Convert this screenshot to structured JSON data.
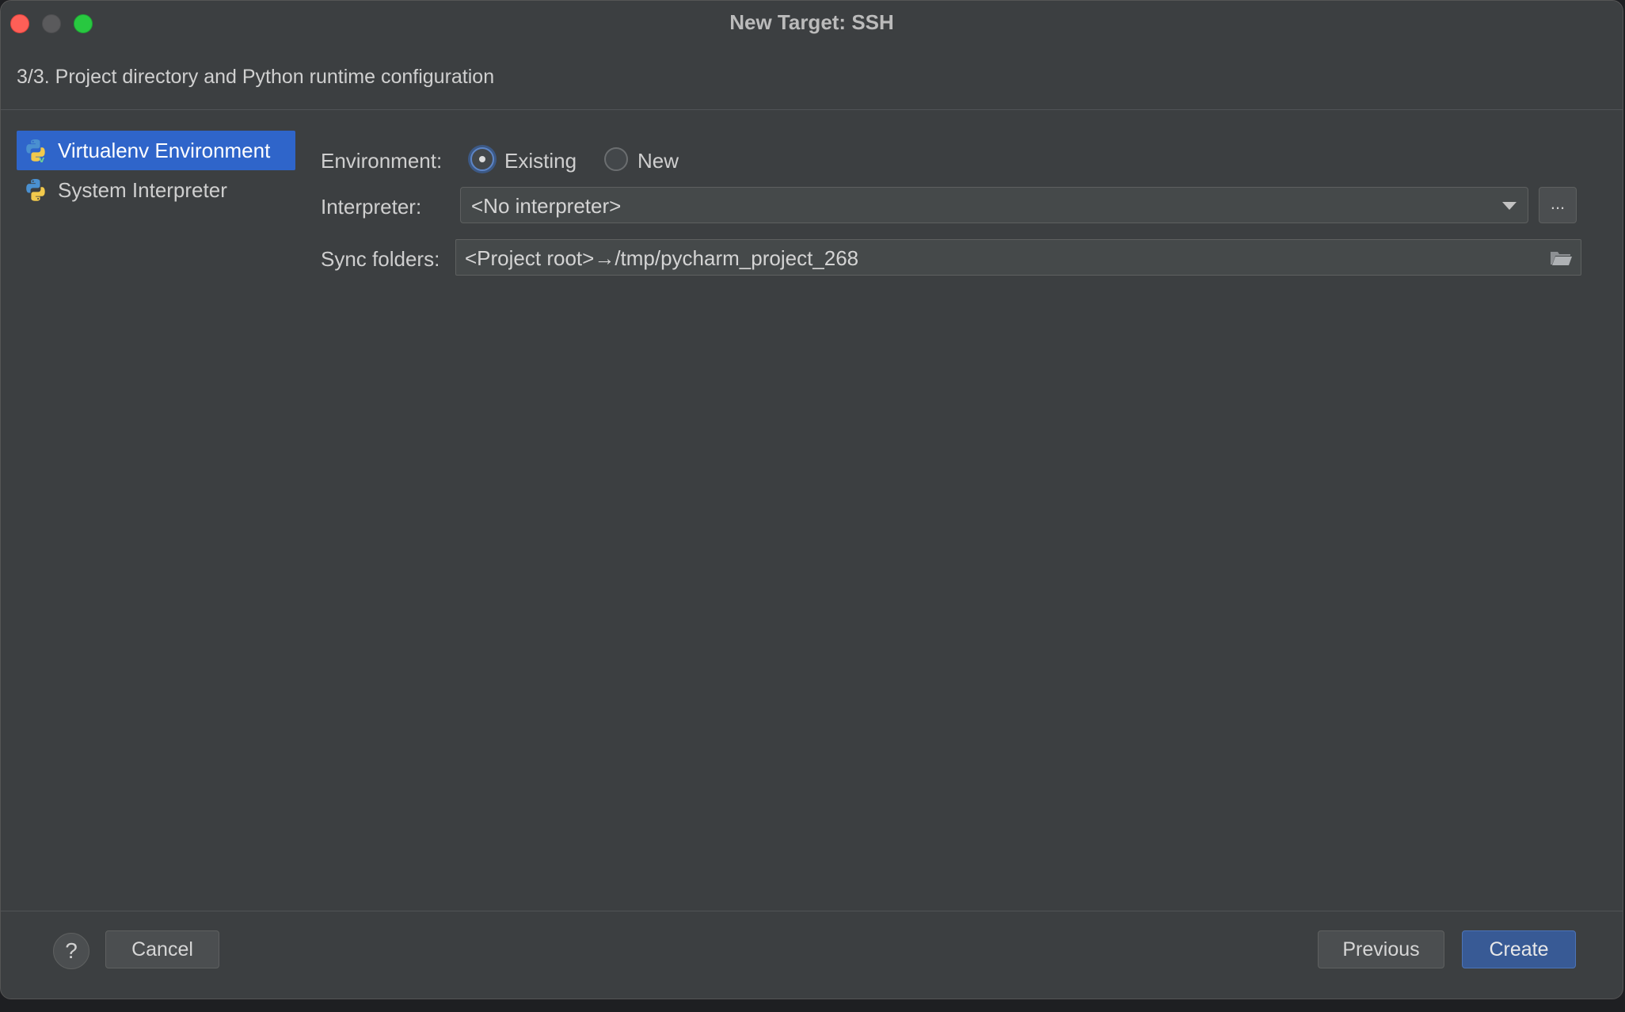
{
  "window": {
    "title": "New Target: SSH"
  },
  "step_header": "3/3. Project directory and Python runtime configuration",
  "env_list": {
    "items": [
      {
        "label": "Virtualenv Environment",
        "icon": "python-virtualenv-icon",
        "selected": true
      },
      {
        "label": "System Interpreter",
        "icon": "python-icon",
        "selected": false
      }
    ]
  },
  "form": {
    "environment_label": "Environment:",
    "environment_options": [
      {
        "label": "Existing",
        "checked": true
      },
      {
        "label": "New",
        "checked": false
      }
    ],
    "interpreter_label": "Interpreter:",
    "interpreter_value": "<No interpreter>",
    "browse_label": "...",
    "sync_label": "Sync folders:",
    "sync_value": "<Project root>→/tmp/pycharm_project_268"
  },
  "footer": {
    "help_label": "?",
    "cancel_label": "Cancel",
    "previous_label": "Previous",
    "create_label": "Create"
  },
  "colors": {
    "window_bg": "#3c3f41",
    "selection": "#2f65ca",
    "primary_button": "#385a95",
    "close": "#fe5f57",
    "maximize": "#28c840"
  }
}
